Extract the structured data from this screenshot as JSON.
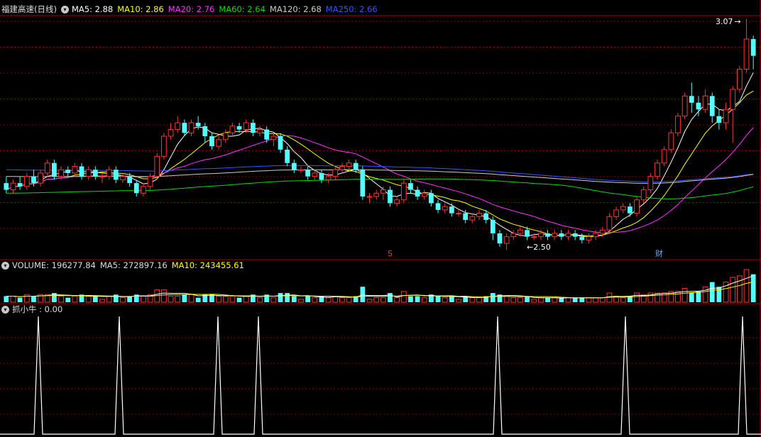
{
  "header": {
    "stock_name": "福建高速(日线)",
    "ma_labels": [
      {
        "text": "MA5: 2.88",
        "color": "#ffffff"
      },
      {
        "text": "MA10: 2.86",
        "color": "#ffff00"
      },
      {
        "text": "MA20: 2.76",
        "color": "#ff33ff"
      },
      {
        "text": "MA60: 2.64",
        "color": "#00dd00"
      },
      {
        "text": "MA120: 2.68",
        "color": "#cccccc"
      },
      {
        "text": "MA250: 2.66",
        "color": "#3355ff"
      }
    ]
  },
  "volume_header": {
    "labels": [
      {
        "text": "VOLUME: 196277.84",
        "color": "#dddddd"
      },
      {
        "text": "MA5: 272897.16",
        "color": "#dddddd"
      },
      {
        "text": "MA10: 243455.61",
        "color": "#ffff00"
      }
    ]
  },
  "indicator_header": {
    "text": "抓小牛 : 0.00"
  },
  "annotations": {
    "high_label": "3.07",
    "low_label": "2.50",
    "marker_left": "S",
    "marker_right": "财"
  },
  "colors": {
    "up": "#ff3333",
    "down": "#54ffff",
    "grid": "#8b0000",
    "ma5": "#ffffff",
    "ma10": "#ffff00",
    "ma20": "#ff33ff",
    "ma60": "#00dd00",
    "ma120": "#cccccc",
    "ma250": "#3355ff"
  },
  "chart_data": {
    "type": "candlestick",
    "title": "福建高速(日线)",
    "price_range": [
      2.5,
      3.07
    ],
    "candles": [
      [
        2.58,
        2.56,
        2.6,
        2.55
      ],
      [
        2.56,
        2.58,
        2.59,
        2.55
      ],
      [
        2.58,
        2.57,
        2.6,
        2.56
      ],
      [
        2.57,
        2.6,
        2.61,
        2.56
      ],
      [
        2.6,
        2.58,
        2.62,
        2.57
      ],
      [
        2.58,
        2.61,
        2.62,
        2.57
      ],
      [
        2.61,
        2.64,
        2.65,
        2.6
      ],
      [
        2.64,
        2.6,
        2.65,
        2.59
      ],
      [
        2.6,
        2.62,
        2.63,
        2.59
      ],
      [
        2.62,
        2.61,
        2.63,
        2.6
      ],
      [
        2.61,
        2.63,
        2.64,
        2.6
      ],
      [
        2.63,
        2.6,
        2.64,
        2.59
      ],
      [
        2.6,
        2.62,
        2.63,
        2.59
      ],
      [
        2.62,
        2.6,
        2.63,
        2.59
      ],
      [
        2.6,
        2.6,
        2.61,
        2.58
      ],
      [
        2.6,
        2.62,
        2.63,
        2.59
      ],
      [
        2.62,
        2.59,
        2.63,
        2.58
      ],
      [
        2.59,
        2.6,
        2.61,
        2.58
      ],
      [
        2.6,
        2.58,
        2.61,
        2.57
      ],
      [
        2.58,
        2.55,
        2.59,
        2.54
      ],
      [
        2.55,
        2.57,
        2.58,
        2.54
      ],
      [
        2.57,
        2.6,
        2.61,
        2.56
      ],
      [
        2.6,
        2.66,
        2.67,
        2.59
      ],
      [
        2.66,
        2.72,
        2.73,
        2.65
      ],
      [
        2.72,
        2.74,
        2.76,
        2.71
      ],
      [
        2.74,
        2.76,
        2.78,
        2.73
      ],
      [
        2.76,
        2.73,
        2.77,
        2.72
      ],
      [
        2.73,
        2.76,
        2.77,
        2.72
      ],
      [
        2.76,
        2.75,
        2.78,
        2.74
      ],
      [
        2.75,
        2.72,
        2.76,
        2.7
      ],
      [
        2.72,
        2.69,
        2.73,
        2.68
      ],
      [
        2.69,
        2.71,
        2.72,
        2.68
      ],
      [
        2.71,
        2.73,
        2.74,
        2.7
      ],
      [
        2.73,
        2.75,
        2.76,
        2.72
      ],
      [
        2.75,
        2.74,
        2.76,
        2.73
      ],
      [
        2.74,
        2.76,
        2.77,
        2.73
      ],
      [
        2.76,
        2.73,
        2.77,
        2.72
      ],
      [
        2.73,
        2.74,
        2.75,
        2.72
      ],
      [
        2.74,
        2.71,
        2.75,
        2.7
      ],
      [
        2.71,
        2.72,
        2.73,
        2.69
      ],
      [
        2.72,
        2.68,
        2.73,
        2.67
      ],
      [
        2.68,
        2.64,
        2.69,
        2.63
      ],
      [
        2.64,
        2.62,
        2.65,
        2.61
      ],
      [
        2.62,
        2.62,
        2.63,
        2.61
      ],
      [
        2.62,
        2.6,
        2.63,
        2.59
      ],
      [
        2.6,
        2.61,
        2.62,
        2.59
      ],
      [
        2.61,
        2.59,
        2.62,
        2.58
      ],
      [
        2.59,
        2.6,
        2.61,
        2.58
      ],
      [
        2.6,
        2.62,
        2.63,
        2.59
      ],
      [
        2.62,
        2.63,
        2.64,
        2.61
      ],
      [
        2.63,
        2.64,
        2.65,
        2.62
      ],
      [
        2.64,
        2.62,
        2.65,
        2.61
      ],
      [
        2.62,
        2.54,
        2.63,
        2.53
      ],
      [
        2.54,
        2.54,
        2.55,
        2.52
      ],
      [
        2.54,
        2.55,
        2.56,
        2.53
      ],
      [
        2.55,
        2.56,
        2.57,
        2.53
      ],
      [
        2.56,
        2.52,
        2.57,
        2.51
      ],
      [
        2.52,
        2.53,
        2.54,
        2.51
      ],
      [
        2.53,
        2.58,
        2.59,
        2.52
      ],
      [
        2.58,
        2.56,
        2.59,
        2.55
      ],
      [
        2.56,
        2.54,
        2.57,
        2.53
      ],
      [
        2.54,
        2.55,
        2.56,
        2.53
      ],
      [
        2.55,
        2.52,
        2.56,
        2.51
      ],
      [
        2.52,
        2.5,
        2.53,
        2.49
      ],
      [
        2.5,
        2.51,
        2.52,
        2.49
      ],
      [
        2.51,
        2.49,
        2.52,
        2.48
      ],
      [
        2.49,
        2.49,
        2.5,
        2.48
      ],
      [
        2.49,
        2.47,
        2.5,
        2.46
      ],
      [
        2.47,
        2.48,
        2.49,
        2.46
      ],
      [
        2.48,
        2.49,
        2.5,
        2.47
      ],
      [
        2.49,
        2.47,
        2.5,
        2.46
      ],
      [
        2.47,
        2.43,
        2.48,
        2.41
      ],
      [
        2.43,
        2.4,
        2.44,
        2.39
      ],
      [
        2.4,
        2.42,
        2.43,
        2.38
      ],
      [
        2.42,
        2.43,
        2.44,
        2.41
      ],
      [
        2.43,
        2.44,
        2.45,
        2.42
      ],
      [
        2.44,
        2.42,
        2.45,
        2.41
      ],
      [
        2.42,
        2.42,
        2.43,
        2.41
      ],
      [
        2.42,
        2.43,
        2.44,
        2.41
      ],
      [
        2.43,
        2.42,
        2.44,
        2.41
      ],
      [
        2.42,
        2.43,
        2.44,
        2.41
      ],
      [
        2.43,
        2.42,
        2.44,
        2.41
      ],
      [
        2.42,
        2.43,
        2.44,
        2.41
      ],
      [
        2.43,
        2.42,
        2.44,
        2.41
      ],
      [
        2.42,
        2.41,
        2.43,
        2.4
      ],
      [
        2.41,
        2.42,
        2.43,
        2.4
      ],
      [
        2.42,
        2.43,
        2.44,
        2.41
      ],
      [
        2.43,
        2.44,
        2.45,
        2.42
      ],
      [
        2.44,
        2.48,
        2.49,
        2.43
      ],
      [
        2.48,
        2.5,
        2.51,
        2.47
      ],
      [
        2.5,
        2.51,
        2.52,
        2.49
      ],
      [
        2.51,
        2.49,
        2.52,
        2.48
      ],
      [
        2.49,
        2.53,
        2.54,
        2.48
      ],
      [
        2.53,
        2.56,
        2.57,
        2.52
      ],
      [
        2.56,
        2.6,
        2.61,
        2.55
      ],
      [
        2.6,
        2.64,
        2.65,
        2.59
      ],
      [
        2.64,
        2.68,
        2.69,
        2.63
      ],
      [
        2.68,
        2.73,
        2.74,
        2.67
      ],
      [
        2.73,
        2.78,
        2.79,
        2.72
      ],
      [
        2.78,
        2.84,
        2.85,
        2.77
      ],
      [
        2.84,
        2.82,
        2.88,
        2.79
      ],
      [
        2.82,
        2.8,
        2.84,
        2.78
      ],
      [
        2.8,
        2.84,
        2.86,
        2.79
      ],
      [
        2.84,
        2.78,
        2.85,
        2.76
      ],
      [
        2.78,
        2.76,
        2.8,
        2.74
      ],
      [
        2.76,
        2.8,
        2.82,
        2.74
      ],
      [
        2.8,
        2.86,
        2.87,
        2.7
      ],
      [
        2.86,
        2.92,
        2.93,
        2.85
      ],
      [
        2.92,
        3.01,
        3.07,
        2.91
      ],
      [
        3.01,
        2.96,
        3.02,
        2.92
      ]
    ],
    "volume": [
      {
        "v": null
      },
      {
        "v": null
      }
    ],
    "indicator": {
      "name": "抓小牛",
      "value": 0.0,
      "signal_indices": [
        9,
        28,
        42,
        54,
        112,
        139,
        162
      ]
    }
  }
}
